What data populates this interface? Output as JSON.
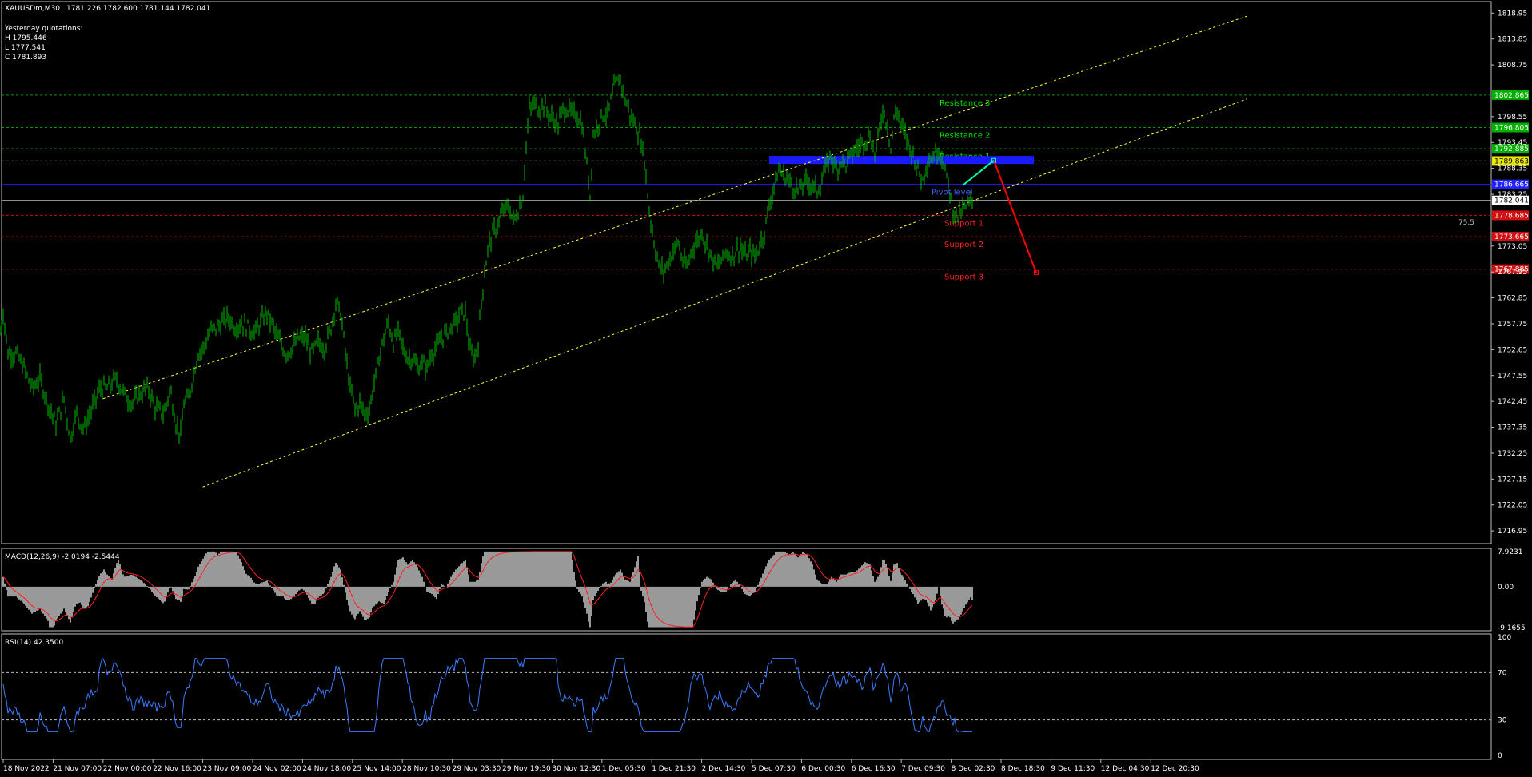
{
  "window": {
    "title": "XAUUSDm,M30",
    "ohlc": "1781.226 1782.600 1781.144 1782.041",
    "info_lines": [
      "Yesterday quotations:",
      "H 1795.446",
      "L 1777.541",
      "C 1781.893"
    ]
  },
  "colors": {
    "background": "#000000",
    "frame": "#c0c0c0",
    "candles": "#00c000",
    "channel": "#ffff33",
    "resistance": "#00c800",
    "pivot": "#1c1cff",
    "support": "#ff1a1a",
    "current_price": "#ffffff",
    "macd_hist": "#c0c0c0",
    "macd_signal": "#ff2020",
    "rsi_line": "#3c7cff",
    "arrow_up": "#00ffa0",
    "arrow_down": "#ff0000"
  },
  "chart_data": {
    "type": "candlestick",
    "symbol": "XAUUSDm",
    "timeframe": "M30",
    "price_axis": {
      "ylim": [
        1714.45,
        1821.2
      ],
      "ticks": [
        1818.95,
        1813.85,
        1808.75,
        1798.55,
        1793.45,
        1788.35,
        1783.25,
        1773.05,
        1767.95,
        1762.85,
        1757.75,
        1752.65,
        1747.55,
        1742.45,
        1737.35,
        1732.25,
        1727.15,
        1722.05,
        1716.95
      ]
    },
    "time_axis": {
      "labels": [
        "18 Nov 2022",
        "21 Nov 07:00",
        "22 Nov 00:00",
        "22 Nov 16:00",
        "23 Nov 09:00",
        "24 Nov 02:00",
        "24 Nov 18:00",
        "25 Nov 14:00",
        "28 Nov 10:30",
        "29 Nov 03:30",
        "29 Nov 19:30",
        "30 Nov 12:30",
        "1 Dec 05:30",
        "1 Dec 21:30",
        "2 Dec 14:30",
        "5 Dec 07:30",
        "6 Dec 00:30",
        "6 Dec 16:30",
        "7 Dec 09:30",
        "8 Dec 02:30",
        "8 Dec 18:30",
        "9 Dec 11:30",
        "12 Dec 04:30",
        "12 Dec 20:30"
      ]
    },
    "price_path": [
      [
        0,
        1756
      ],
      [
        4,
        1760
      ],
      [
        10,
        1752
      ],
      [
        20,
        1752
      ],
      [
        30,
        1749
      ],
      [
        40,
        1745
      ],
      [
        50,
        1747
      ],
      [
        60,
        1742
      ],
      [
        70,
        1738
      ],
      [
        80,
        1743
      ],
      [
        88,
        1735
      ],
      [
        95,
        1740
      ],
      [
        105,
        1737
      ],
      [
        115,
        1741
      ],
      [
        125,
        1745
      ],
      [
        135,
        1745
      ],
      [
        145,
        1747
      ],
      [
        155,
        1744
      ],
      [
        165,
        1742
      ],
      [
        175,
        1744
      ],
      [
        185,
        1745
      ],
      [
        195,
        1741
      ],
      [
        205,
        1740
      ],
      [
        213,
        1745
      ],
      [
        220,
        1738
      ],
      [
        226,
        1736
      ],
      [
        230,
        1742
      ],
      [
        236,
        1743
      ],
      [
        242,
        1748
      ],
      [
        248,
        1752
      ],
      [
        255,
        1753
      ],
      [
        262,
        1756
      ],
      [
        270,
        1757
      ],
      [
        278,
        1758
      ],
      [
        286,
        1759
      ],
      [
        294,
        1757
      ],
      [
        302,
        1758
      ],
      [
        310,
        1757
      ],
      [
        318,
        1756
      ],
      [
        326,
        1758
      ],
      [
        334,
        1760
      ],
      [
        342,
        1757
      ],
      [
        350,
        1754
      ],
      [
        358,
        1752
      ],
      [
        366,
        1753
      ],
      [
        374,
        1755
      ],
      [
        382,
        1755
      ],
      [
        390,
        1752
      ],
      [
        398,
        1754
      ],
      [
        406,
        1753
      ],
      [
        414,
        1757
      ],
      [
        420,
        1762
      ],
      [
        426,
        1760
      ],
      [
        432,
        1752
      ],
      [
        438,
        1745
      ],
      [
        444,
        1741
      ],
      [
        450,
        1742
      ],
      [
        456,
        1740
      ],
      [
        462,
        1741
      ],
      [
        468,
        1746
      ],
      [
        474,
        1751
      ],
      [
        480,
        1755
      ],
      [
        486,
        1758
      ],
      [
        492,
        1754
      ],
      [
        498,
        1756
      ],
      [
        504,
        1753
      ],
      [
        510,
        1751
      ],
      [
        516,
        1751
      ],
      [
        522,
        1749
      ],
      [
        528,
        1750
      ],
      [
        534,
        1749
      ],
      [
        540,
        1752
      ],
      [
        546,
        1753
      ],
      [
        552,
        1755
      ],
      [
        558,
        1756
      ],
      [
        564,
        1757
      ],
      [
        570,
        1758
      ],
      [
        576,
        1760
      ],
      [
        582,
        1760
      ],
      [
        588,
        1752
      ],
      [
        594,
        1751
      ],
      [
        598,
        1754
      ],
      [
        602,
        1762
      ],
      [
        606,
        1768
      ],
      [
        612,
        1774
      ],
      [
        618,
        1776
      ],
      [
        624,
        1778
      ],
      [
        630,
        1780
      ],
      [
        636,
        1781
      ],
      [
        642,
        1778
      ],
      [
        648,
        1780
      ],
      [
        654,
        1783
      ],
      [
        658,
        1793
      ],
      [
        662,
        1800
      ],
      [
        668,
        1801
      ],
      [
        674,
        1800
      ],
      [
        680,
        1801
      ],
      [
        686,
        1799
      ],
      [
        692,
        1798
      ],
      [
        698,
        1797
      ],
      [
        704,
        1800
      ],
      [
        710,
        1800
      ],
      [
        716,
        1799
      ],
      [
        722,
        1799
      ],
      [
        728,
        1797
      ],
      [
        734,
        1789
      ],
      [
        738,
        1783
      ],
      [
        742,
        1795
      ],
      [
        748,
        1797
      ],
      [
        754,
        1799
      ],
      [
        760,
        1799
      ],
      [
        766,
        1803
      ],
      [
        770,
        1805
      ],
      [
        776,
        1806
      ],
      [
        782,
        1802
      ],
      [
        788,
        1799
      ],
      [
        794,
        1797
      ],
      [
        800,
        1795
      ],
      [
        806,
        1790
      ],
      [
        812,
        1780
      ],
      [
        818,
        1774
      ],
      [
        824,
        1769
      ],
      [
        830,
        1768
      ],
      [
        836,
        1770
      ],
      [
        842,
        1772
      ],
      [
        848,
        1774
      ],
      [
        854,
        1770
      ],
      [
        860,
        1769
      ],
      [
        866,
        1773
      ],
      [
        872,
        1774
      ],
      [
        878,
        1776
      ],
      [
        884,
        1773
      ],
      [
        890,
        1771
      ],
      [
        896,
        1769
      ],
      [
        902,
        1770
      ],
      [
        908,
        1772
      ],
      [
        914,
        1771
      ],
      [
        920,
        1772
      ],
      [
        926,
        1773
      ],
      [
        932,
        1771
      ],
      [
        938,
        1772
      ],
      [
        944,
        1771
      ],
      [
        950,
        1773
      ],
      [
        956,
        1776
      ],
      [
        962,
        1781
      ],
      [
        968,
        1785
      ],
      [
        974,
        1788
      ],
      [
        980,
        1787
      ],
      [
        986,
        1786
      ],
      [
        992,
        1785
      ],
      [
        998,
        1784
      ],
      [
        1004,
        1785
      ],
      [
        1010,
        1786
      ],
      [
        1016,
        1785
      ],
      [
        1022,
        1784
      ],
      [
        1028,
        1786
      ],
      [
        1034,
        1789
      ],
      [
        1040,
        1791
      ],
      [
        1046,
        1788
      ],
      [
        1052,
        1790
      ],
      [
        1058,
        1789
      ],
      [
        1064,
        1791
      ],
      [
        1070,
        1792
      ],
      [
        1076,
        1793
      ],
      [
        1082,
        1794
      ],
      [
        1088,
        1795
      ],
      [
        1094,
        1791
      ],
      [
        1100,
        1796
      ],
      [
        1104,
        1800
      ],
      [
        1110,
        1797
      ],
      [
        1114,
        1792
      ],
      [
        1118,
        1798
      ],
      [
        1122,
        1800
      ],
      [
        1126,
        1797
      ],
      [
        1130,
        1796
      ],
      [
        1136,
        1793
      ],
      [
        1142,
        1791
      ],
      [
        1148,
        1788
      ],
      [
        1154,
        1786
      ],
      [
        1158,
        1789
      ],
      [
        1162,
        1790
      ],
      [
        1168,
        1791
      ],
      [
        1174,
        1792
      ],
      [
        1180,
        1790
      ],
      [
        1184,
        1786
      ],
      [
        1188,
        1784
      ],
      [
        1192,
        1780
      ],
      [
        1198,
        1779
      ],
      [
        1204,
        1780
      ],
      [
        1210,
        1781
      ],
      [
        1216,
        1782
      ]
    ],
    "channel_lines": [
      {
        "from": [
          "22 Nov 00:00",
          1743
        ],
        "to": [
          "12 Dec 20:30",
          1812
        ],
        "label": ""
      },
      {
        "from": [
          "23 Nov 09:00",
          1725.6
        ],
        "to": [
          "12 Dec 20:30",
          1795
        ],
        "label": ""
      }
    ],
    "levels": [
      {
        "label": "Resistance 3",
        "price": 1802.8,
        "tag": "1802.865",
        "style": "resistance",
        "label_at": 1175
      },
      {
        "label": "Resistance 2",
        "price": 1796.4,
        "tag": "1796.805",
        "style": "resistance",
        "label_at": 1175
      },
      {
        "label": "Resistance 1",
        "price": 1792.2,
        "tag": "1792.885",
        "style": "resistance",
        "label_at": 1175
      },
      {
        "label": "",
        "price": 1789.8,
        "tag": "1789.863",
        "style": "yellow",
        "label_at": 0
      },
      {
        "label": "Pivot level",
        "price": 1785.2,
        "tag": "1786.665",
        "style": "pivot",
        "label_at": 1165
      },
      {
        "label": "",
        "price": 1782.04,
        "tag": "1782.041",
        "style": "current",
        "label_at": 0
      },
      {
        "label": "Support 1",
        "price": 1779.1,
        "tag": "1778.685",
        "style": "support",
        "label_at": 1181
      },
      {
        "label": "Support 2",
        "price": 1774.9,
        "tag": "1773.665",
        "style": "support",
        "label_at": 1181
      },
      {
        "label": "Support 3",
        "price": 1768.5,
        "tag": "1767.885",
        "style": "support",
        "label_at": 1181
      }
    ],
    "pivot_zone": {
      "x_from": 962,
      "x_to": 1293,
      "price": 1790
    },
    "fib_label": "75.5",
    "projection": [
      {
        "from": [
          1204,
          1785.0
        ],
        "to": [
          1243,
          1789.9
        ],
        "color": "up"
      },
      {
        "from": [
          1243,
          1789.9
        ],
        "to": [
          1296,
          1767.8
        ],
        "color": "down"
      }
    ],
    "macd": {
      "title": "MACD(12,26,9) -2.0194 -2.5444",
      "fast": 12,
      "slow": 26,
      "signal": 9,
      "value": -2.0194,
      "signal_value": -2.5444,
      "ylim": [
        -9.9,
        8.6
      ],
      "ticks": [
        {
          "label": "7.9231",
          "v": 7.9231
        },
        {
          "label": "0.00",
          "v": 0
        },
        {
          "label": "-9.1655",
          "v": -9.1655
        }
      ]
    },
    "rsi": {
      "title": "RSI(14) 42.3500",
      "period": 14,
      "value": 42.35,
      "ylim": [
        0,
        100
      ],
      "ticks": [
        {
          "label": "100",
          "v": 100
        },
        {
          "label": "70",
          "v": 70
        },
        {
          "label": "30",
          "v": 30
        },
        {
          "label": "0",
          "v": 0
        }
      ],
      "levels": [
        70,
        30
      ]
    }
  }
}
